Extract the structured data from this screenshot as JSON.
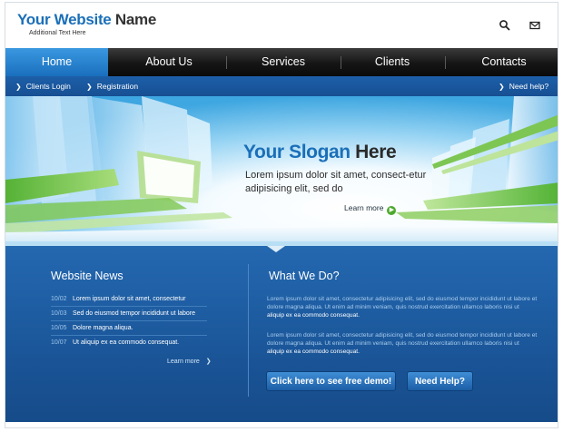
{
  "header": {
    "logo_part1": "Your Website",
    "logo_part2": "Name",
    "tagline": "Additional Text Here",
    "icons": [
      "search-icon",
      "mail-icon"
    ]
  },
  "nav": {
    "items": [
      {
        "label": "Home",
        "active": true
      },
      {
        "label": "About Us",
        "active": false
      },
      {
        "label": "Services",
        "active": false
      },
      {
        "label": "Clients",
        "active": false
      },
      {
        "label": "Contacts",
        "active": false
      }
    ]
  },
  "subbar": {
    "links": [
      "Clients Login",
      "Registration"
    ],
    "help": "Need help?"
  },
  "hero": {
    "slogan_part1": "Your Slogan",
    "slogan_part2": "Here",
    "text": "Lorem ipsum dolor sit amet, consect-etur adipisicing elit, sed do",
    "learn_more": "Learn more"
  },
  "news": {
    "title": "Website News",
    "items": [
      {
        "date": "10/02",
        "text": "Lorem ipsum dolor sit amet, consectetur"
      },
      {
        "date": "10/03",
        "text": "Sed do eiusmod tempor incididunt ut labore"
      },
      {
        "date": "10/05",
        "text": "Dolore magna aliqua."
      },
      {
        "date": "10/07",
        "text": "Ut aliquip ex ea commodo consequat."
      }
    ],
    "more": "Learn more"
  },
  "what": {
    "title": "What We Do?",
    "para1_main": "Lorem ipsum dolor sit amet, consectetur adipisicing elit, sed do eiusmod tempor incididunt ut labore et dolore magna aliqua. Ut enim ad minim veniam, quis nostrud exercitation ullamco laboris nisi ut",
    "para1_highlight": "aliquip ex ea commodo consequat.",
    "para2_main": "Lorem ipsum dolor sit amet, consectetur adipisicing elit, sed do eiusmod tempor incididunt ut labore et dolore magna aliqua. Ut enim ad minim veniam, quis nostrud exercitation ullamco laboris nisi ut",
    "para2_highlight": "aliquip ex ea commodo consequat.",
    "demo_button": "Click here to see free demo!",
    "help_button": "Need Help?"
  },
  "colors": {
    "brand_blue": "#1a6fb8",
    "nav_dark": "#151515",
    "content_blue": "#1a5598",
    "accent_green": "#4caa2d"
  }
}
